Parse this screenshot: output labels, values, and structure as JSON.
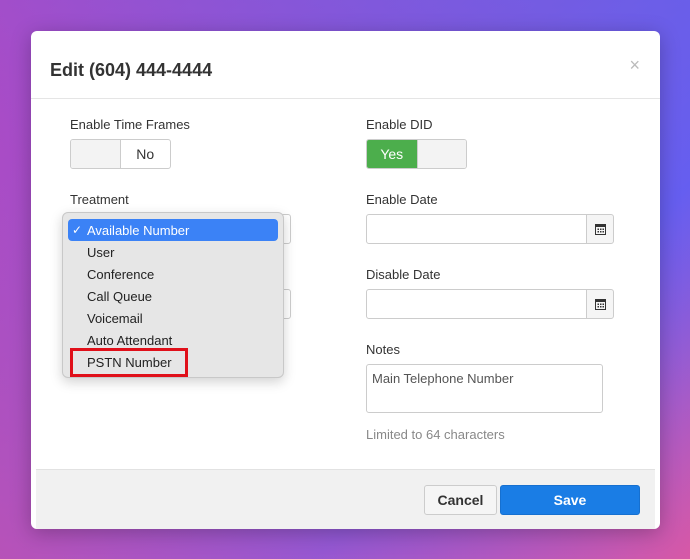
{
  "modal": {
    "title": "Edit (604) 444-4444",
    "close_label": "×"
  },
  "fields": {
    "enable_time_frames": {
      "label": "Enable Time Frames",
      "value": "No"
    },
    "enable_did": {
      "label": "Enable DID",
      "value": "Yes"
    },
    "treatment": {
      "label": "Treatment",
      "selected": "Available Number"
    },
    "enable_date": {
      "label": "Enable Date",
      "value": ""
    },
    "disable_date": {
      "label": "Disable Date",
      "value": ""
    },
    "notes": {
      "label": "Notes",
      "value": "Main Telephone Number",
      "hint": "Limited to 64 characters"
    }
  },
  "dropdown": {
    "items": [
      {
        "label": "Available Number",
        "selected": true
      },
      {
        "label": "User"
      },
      {
        "label": "Conference"
      },
      {
        "label": "Call Queue"
      },
      {
        "label": "Voicemail"
      },
      {
        "label": "Auto Attendant"
      },
      {
        "label": "PSTN Number",
        "highlighted": true
      }
    ]
  },
  "footer": {
    "cancel_label": "Cancel",
    "save_label": "Save"
  },
  "colors": {
    "primary": "#1a7de5",
    "toggle_on": "#4cae4c",
    "highlight": "#e0101a"
  }
}
